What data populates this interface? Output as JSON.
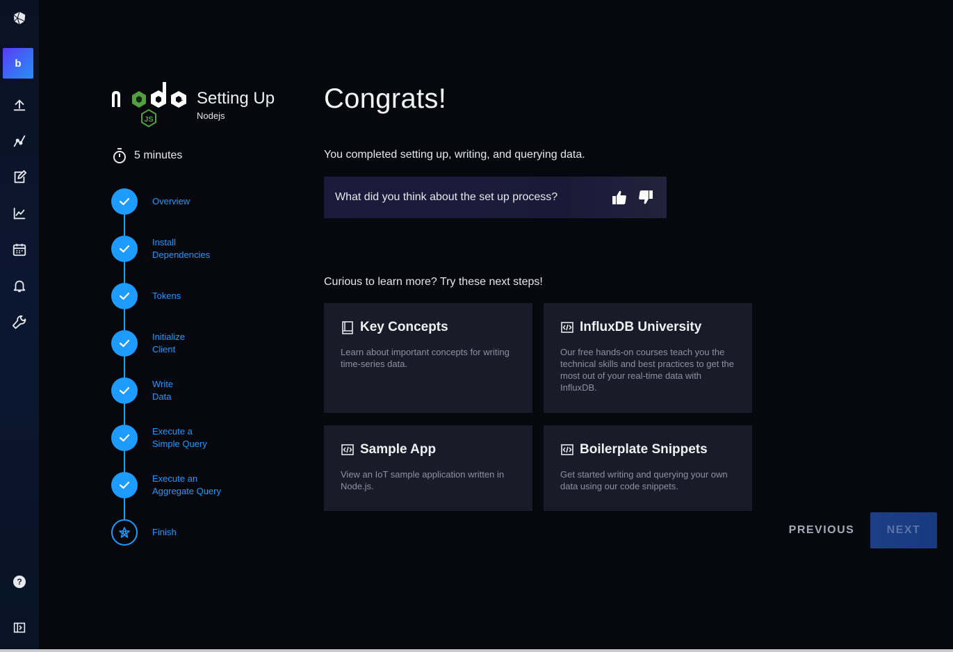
{
  "nav": {
    "org_initial": "b",
    "icons": [
      "influx-logo-icon",
      "upload-icon",
      "data-explorer-icon",
      "notebook-icon",
      "dashboard-icon",
      "tasks-calendar-icon",
      "alerts-bell-icon",
      "settings-wrench-icon",
      "help-icon",
      "collapse-nav-icon"
    ],
    "help_glyph": "?"
  },
  "setup": {
    "title": "Setting Up",
    "subtitle": "Nodejs",
    "duration": "5 minutes",
    "steps": [
      {
        "line1": "Overview",
        "line2": "",
        "state": "done"
      },
      {
        "line1": "Install",
        "line2": "Dependencies",
        "state": "done"
      },
      {
        "line1": "Tokens",
        "line2": "",
        "state": "done"
      },
      {
        "line1": "Initialize",
        "line2": "Client",
        "state": "done"
      },
      {
        "line1": "Write",
        "line2": "Data",
        "state": "done"
      },
      {
        "line1": "Execute a",
        "line2": "Simple Query",
        "state": "done"
      },
      {
        "line1": "Execute an",
        "line2": "Aggregate Query",
        "state": "done"
      },
      {
        "line1": "Finish",
        "line2": "",
        "state": "current"
      }
    ]
  },
  "main": {
    "heading": "Congrats!",
    "completed_text": "You completed setting up, writing, and querying data.",
    "feedback_question": "What did you think about the set up process?",
    "curious_text": "Curious to learn more? Try these next steps!",
    "cards": [
      {
        "title": "Key Concepts",
        "icon": "book-icon",
        "desc": "Learn about important concepts for writing time-series data."
      },
      {
        "title": "InfluxDB University",
        "icon": "code-icon",
        "desc": "Our free hands-on courses teach you the technical skills and best practices to get the most out of your real-time data with InfluxDB."
      },
      {
        "title": "Sample App",
        "icon": "code-icon",
        "desc": "View an IoT sample application written in Node.js."
      },
      {
        "title": "Boilerplate Snippets",
        "icon": "code-icon",
        "desc": "Get started writing and querying your own data using our code snippets."
      }
    ],
    "previous_label": "PREVIOUS",
    "next_label": "NEXT"
  },
  "colors": {
    "accent": "#1e9bff",
    "background": "#07070e",
    "card": "#1a1a29",
    "node_green": "#539e43"
  }
}
